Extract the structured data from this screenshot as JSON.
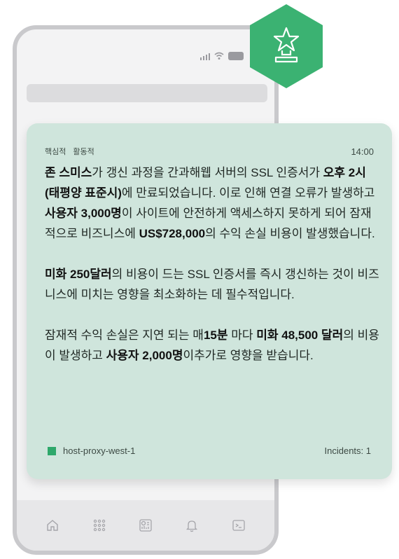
{
  "colors": {
    "badge": "#3bb272",
    "card_bg": "#cfe5dc",
    "host_indicator": "#2ea86b",
    "phone_frame": "#c9c9cc"
  },
  "badge": {
    "icon": "trophy-star-icon"
  },
  "card": {
    "tags": [
      "핵심적",
      "활동적"
    ],
    "time": "14:00",
    "paragraphs": [
      [
        {
          "text": "존 스미스",
          "bold": true
        },
        {
          "text": "가 갱신 과정을 간과해웹 서버의 SSL 인증서가 ",
          "bold": false
        },
        {
          "text": "오후 2시(태평양 표준시)",
          "bold": true
        },
        {
          "text": "에 만료되었습니다. 이로 인해 연결 오류가 발생하고 ",
          "bold": false
        },
        {
          "text": "사용자 3,000명",
          "bold": true
        },
        {
          "text": "이 사이트에 안전하게 액세스하지 못하게 되어 잠재적으로 비즈니스에 ",
          "bold": false
        },
        {
          "text": "US$728,000",
          "bold": true
        },
        {
          "text": "의 수익 손실 비용이 발생했습니다.",
          "bold": false
        }
      ],
      [
        {
          "text": "미화 250달러",
          "bold": true
        },
        {
          "text": "의 비용이 드는 SSL 인증서를 즉시 갱신하는 것이 비즈니스에 미치는 영향을 최소화하는 데 필수적입니다.",
          "bold": false
        }
      ],
      [
        {
          "text": "잠재적 수익 손실은 지연 되는 매",
          "bold": false
        },
        {
          "text": "15분",
          "bold": true
        },
        {
          "text": " 마다 ",
          "bold": false
        },
        {
          "text": "미화 48,500 달러",
          "bold": true
        },
        {
          "text": "의 비용이 발생하고 ",
          "bold": false
        },
        {
          "text": "사용자 2,000명",
          "bold": true
        },
        {
          "text": "이추가로 영향을 받습니다.",
          "bold": false
        }
      ]
    ],
    "host": "host-proxy-west-1",
    "incidents": "Incidents: 1"
  },
  "tab_bar": {
    "items": [
      "home-icon",
      "apps-grid-icon",
      "dashboard-icon",
      "bell-icon",
      "terminal-icon"
    ]
  }
}
